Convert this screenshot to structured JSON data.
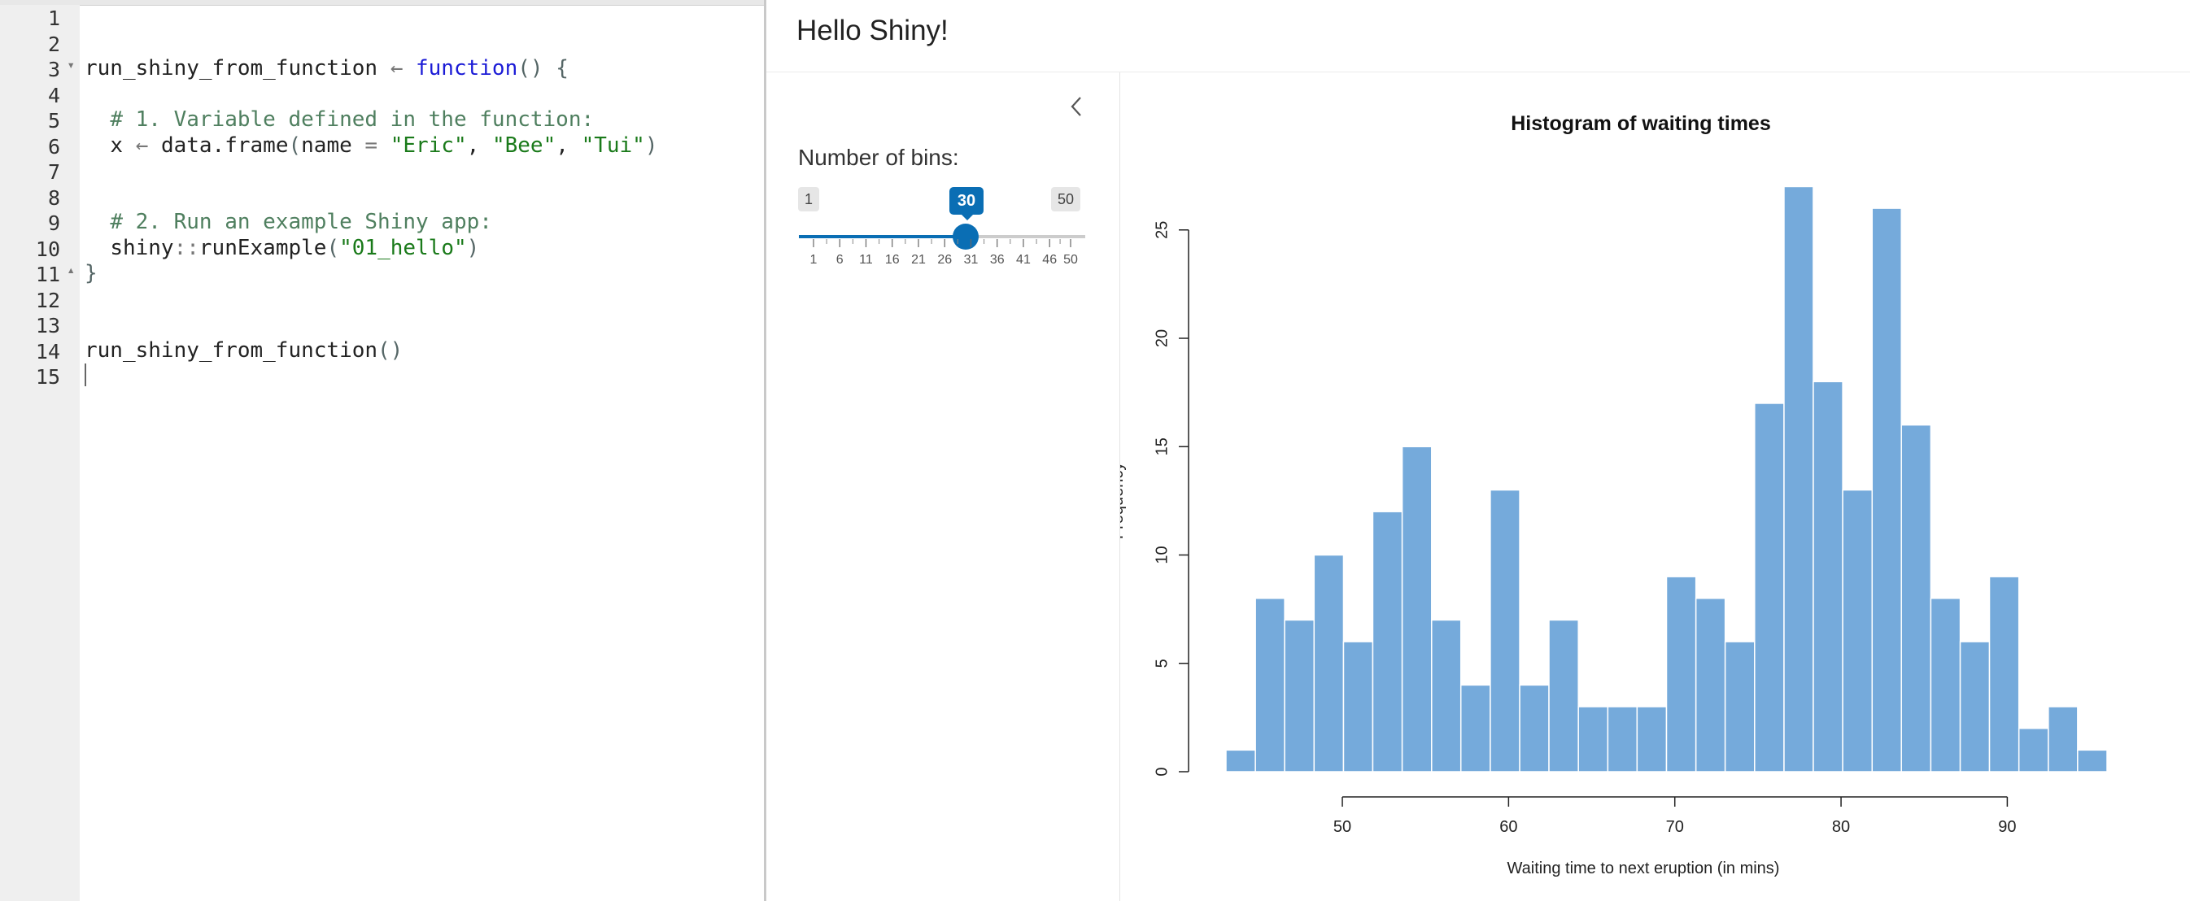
{
  "editor": {
    "line_numbers": [
      "1",
      "2",
      "3",
      "4",
      "5",
      "6",
      "7",
      "8",
      "9",
      "10",
      "11",
      "12",
      "13",
      "14",
      "15"
    ],
    "code": {
      "l3_fn_name": "run_shiny_from_function",
      "l3_assign": "←",
      "l3_kw": "function",
      "l3_parens": "()",
      "l3_brace": "{",
      "l5_comment": "# 1. Variable defined in the function:",
      "l6_var": "x",
      "l6_assign": "←",
      "l6_call": "data.frame",
      "l6_open": "(",
      "l6_arg": "name",
      "l6_eq": "=",
      "l6_s1": "\"Eric\"",
      "l6_s2": "\"Bee\"",
      "l6_s3": "\"Tui\"",
      "l6_close": ")",
      "l9_comment": "# 2. Run an example Shiny app:",
      "l10_ns": "shiny",
      "l10_sep": "::",
      "l10_fn": "runExample",
      "l10_open": "(",
      "l10_str": "\"01_hello\"",
      "l10_close": ")",
      "l11_brace": "}",
      "l14_call": "run_shiny_from_function",
      "l14_parens": "()"
    }
  },
  "app": {
    "title": "Hello Shiny!",
    "sidebar": {
      "label": "Number of bins:",
      "min": 1,
      "max": 50,
      "value": 30,
      "min_label": "1",
      "max_label": "50",
      "value_label": "30",
      "tick_labels": [
        "1",
        "6",
        "11",
        "16",
        "21",
        "26",
        "31",
        "36",
        "41",
        "46",
        "50"
      ],
      "accent_color": "#0a6eb4"
    }
  },
  "chart_data": {
    "type": "bar",
    "title": "Histogram of waiting times",
    "xlabel": "Waiting time to next eruption (in mins)",
    "ylabel": "Frequency",
    "bar_color": "#75aadb",
    "x_ticks": [
      50,
      60,
      70,
      80,
      90
    ],
    "y_ticks": [
      0,
      5,
      10,
      15,
      20,
      25
    ],
    "ylim": [
      0,
      27
    ],
    "bin_edges": [
      43.0,
      44.77,
      46.53,
      48.3,
      50.07,
      51.83,
      53.6,
      55.37,
      57.13,
      58.9,
      60.67,
      62.43,
      64.2,
      65.97,
      67.73,
      69.5,
      71.27,
      73.03,
      74.8,
      76.57,
      78.33,
      80.1,
      81.87,
      83.63,
      85.4,
      87.17,
      88.93,
      90.7,
      92.47,
      94.23,
      96.0
    ],
    "values": [
      1,
      8,
      7,
      10,
      6,
      12,
      15,
      7,
      4,
      13,
      4,
      7,
      3,
      3,
      3,
      9,
      8,
      6,
      17,
      27,
      18,
      13,
      26,
      16,
      8,
      6,
      9,
      2,
      3,
      1
    ]
  }
}
